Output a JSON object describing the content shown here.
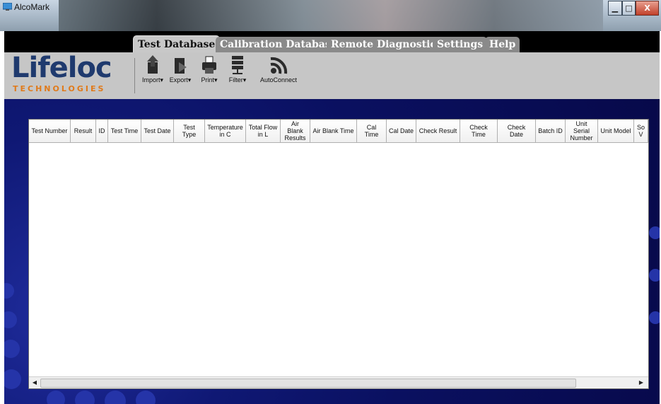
{
  "window": {
    "title": "AlcoMark",
    "minimize_glyph": "▁",
    "maximize_glyph": "□",
    "close_glyph": "X"
  },
  "tabs": [
    {
      "label": "Test Database",
      "active": true
    },
    {
      "label": "Calibration Database",
      "active": false
    },
    {
      "label": "Remote Diagnostics",
      "active": false
    },
    {
      "label": "Settings",
      "active": false
    },
    {
      "label": "Help",
      "active": false
    }
  ],
  "logo": {
    "name": "Lifeloc",
    "tagline": "TECHNOLOGIES"
  },
  "toolbar": [
    {
      "label": "Import",
      "icon": "import-icon",
      "dropdown": true
    },
    {
      "label": "Export",
      "icon": "export-icon",
      "dropdown": true
    },
    {
      "label": "Print",
      "icon": "print-icon",
      "dropdown": true
    },
    {
      "label": "Filter",
      "icon": "filter-icon",
      "dropdown": true
    },
    {
      "label": "AutoConnect",
      "icon": "autoconnect-icon",
      "dropdown": false
    }
  ],
  "grid": {
    "columns": [
      "Test Number",
      "Result",
      "ID",
      "Test Time",
      "Test Date",
      "Test Type",
      "Temperature\nin C",
      "Total Flow\nin L",
      "Air Blank\nResults",
      "Air Blank Time",
      "Cal Time",
      "Cal Date",
      "Check Result",
      "Check Time",
      "Check Date",
      "Batch ID",
      "Unit Serial\nNumber",
      "Unit Model",
      "So\nV"
    ],
    "rows": []
  },
  "colors": {
    "brand_blue": "#1f3a6e",
    "brand_orange": "#e07a1a",
    "workspace": "#0a1060"
  },
  "scroll": {
    "left": "◀",
    "right": "▶"
  }
}
